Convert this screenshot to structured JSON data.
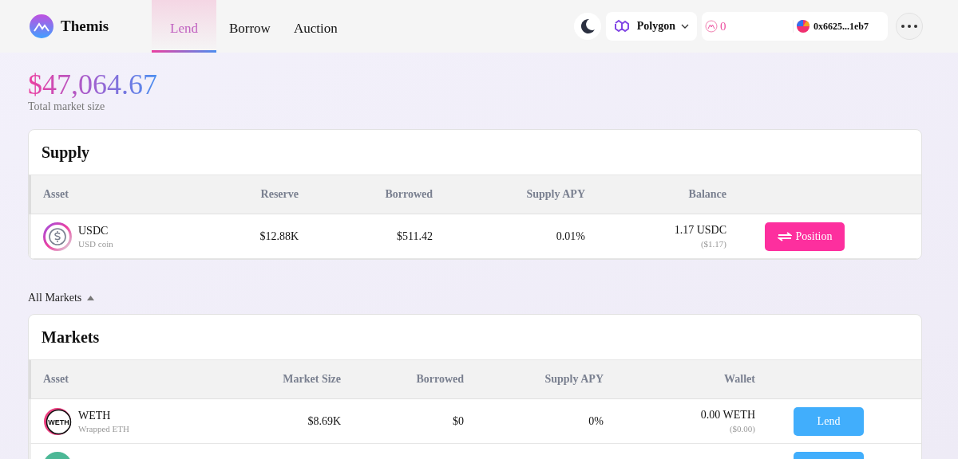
{
  "brand": {
    "name": "Themis"
  },
  "nav": [
    {
      "label": "Lend",
      "selected": true
    },
    {
      "label": "Borrow",
      "selected": false
    },
    {
      "label": "Auction",
      "selected": false
    }
  ],
  "network": {
    "name": "Polygon"
  },
  "account": {
    "points": "0",
    "address": "0x6625...1eb7"
  },
  "summary": {
    "value": "$47,064.67",
    "label": "Total market size"
  },
  "supply": {
    "title": "Supply",
    "columns": [
      "Asset",
      "Reserve",
      "Borrowed",
      "Supply APY",
      "Balance"
    ],
    "rows": [
      {
        "kind": "full",
        "icon": {
          "kind": "usdc"
        },
        "symbol": "USDC",
        "name": "USD coin",
        "reserve": "$12.88K",
        "borrowed": "$511.42",
        "supply_apy": "0.01%",
        "amount": "1.17 USDC",
        "amount_usd": "($1.17)",
        "action": "Position"
      }
    ]
  },
  "filter": {
    "label": "All Markets",
    "expanded": true
  },
  "markets": {
    "title": "Markets",
    "columns": [
      "Asset",
      "Market Size",
      "Borrowed",
      "Supply APY",
      "Wallet"
    ],
    "rows": [
      {
        "kind": "full",
        "icon": {
          "kind": "weth",
          "text": "WETH"
        },
        "symbol": "WETH",
        "name": "Wrapped ETH",
        "market_size": "$8.69K",
        "borrowed": "$0",
        "supply_apy": "0%",
        "amount": "0.00 WETH",
        "amount_usd": "($0.00)",
        "action": "Lend"
      },
      {
        "kind": "cut",
        "icon": {
          "kind": "plain"
        }
      }
    ]
  }
}
